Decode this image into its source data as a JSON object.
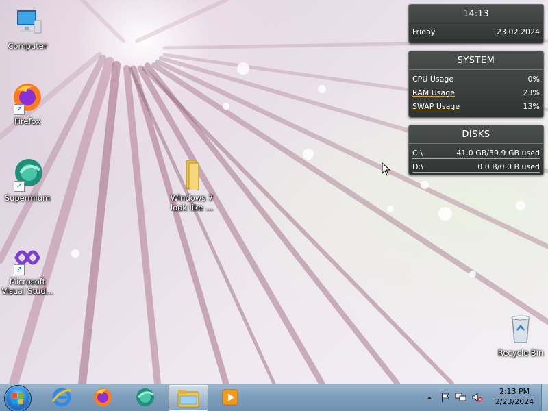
{
  "desktop_icons": [
    {
      "name": "computer",
      "label": "Computer"
    },
    {
      "name": "firefox",
      "label": "Firefox"
    },
    {
      "name": "supermium",
      "label": "Supermium"
    },
    {
      "name": "visual-studio",
      "label": "Microsoft Visual Stud..."
    },
    {
      "name": "folder",
      "label": "Windows 7 look like ..."
    },
    {
      "name": "recycle-bin",
      "label": "Recycle Bin"
    }
  ],
  "clock_gadget": {
    "time": "14:13",
    "day": "Friday",
    "date": "23.02.2024"
  },
  "system_gadget": {
    "title": "SYSTEM",
    "rows": [
      {
        "label": "CPU Usage",
        "value": "0%"
      },
      {
        "label": "RAM Usage",
        "value": "23%"
      },
      {
        "label": "SWAP Usage",
        "value": "13%"
      }
    ]
  },
  "disks_gadget": {
    "title": "DISKS",
    "rows": [
      {
        "label": "C:\\",
        "value": "41.0 GB/59.9 GB used"
      },
      {
        "label": "D:\\",
        "value": "0.0 B/0.0 B used"
      }
    ]
  },
  "taskbar": {
    "pinned": [
      "start-orb",
      "internet-explorer",
      "firefox",
      "supermium",
      "file-explorer",
      "media-player"
    ],
    "clock_time": "2:13 PM",
    "clock_date": "2/23/2024"
  },
  "colors": {
    "gadget_bg": "#3b3f3d",
    "gadget_accent": "#d3a53a",
    "taskbar": "#7f9fbd"
  }
}
